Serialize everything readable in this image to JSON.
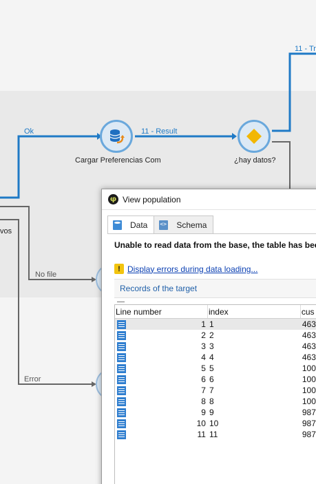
{
  "workflow": {
    "labels": {
      "ok": "Ok",
      "result": "11 - Result",
      "top_right": "11 - Tr",
      "no_file": "No file",
      "error": "Error",
      "vos": "vos"
    },
    "nodes": {
      "cargar": {
        "label": "Cargar Preferencias Com",
        "icon": "database-load-icon"
      },
      "hay_datos": {
        "label": "¿hay datos?",
        "icon": "diamond-test-icon"
      }
    },
    "colors": {
      "active_wire": "#1f7ac6",
      "inactive_wire": "#666666",
      "node_ring": "#6aa8dc",
      "node_fill": "#dce9f5",
      "diamond": "#f2b705"
    }
  },
  "popup": {
    "title": "View population",
    "tabs": [
      {
        "label": "Data",
        "icon": "sql-icon",
        "active": true
      },
      {
        "label": "Schema",
        "icon": "schema-icon",
        "active": false
      }
    ],
    "error_message": "Unable to read data from the base, the table has bee",
    "errors_link": "Display errors during data loading...",
    "records_header": "Records of the target",
    "table": {
      "columns": [
        "Line number",
        "index",
        "cus"
      ],
      "rows": [
        {
          "line": "1",
          "index": "1",
          "cus": "463"
        },
        {
          "line": "2",
          "index": "2",
          "cus": "463"
        },
        {
          "line": "3",
          "index": "3",
          "cus": "463"
        },
        {
          "line": "4",
          "index": "4",
          "cus": "463"
        },
        {
          "line": "5",
          "index": "5",
          "cus": "100"
        },
        {
          "line": "6",
          "index": "6",
          "cus": "100"
        },
        {
          "line": "7",
          "index": "7",
          "cus": "100"
        },
        {
          "line": "8",
          "index": "8",
          "cus": "100"
        },
        {
          "line": "9",
          "index": "9",
          "cus": "987"
        },
        {
          "line": "10",
          "index": "10",
          "cus": "987"
        },
        {
          "line": "11",
          "index": "11",
          "cus": "987"
        }
      ]
    }
  }
}
